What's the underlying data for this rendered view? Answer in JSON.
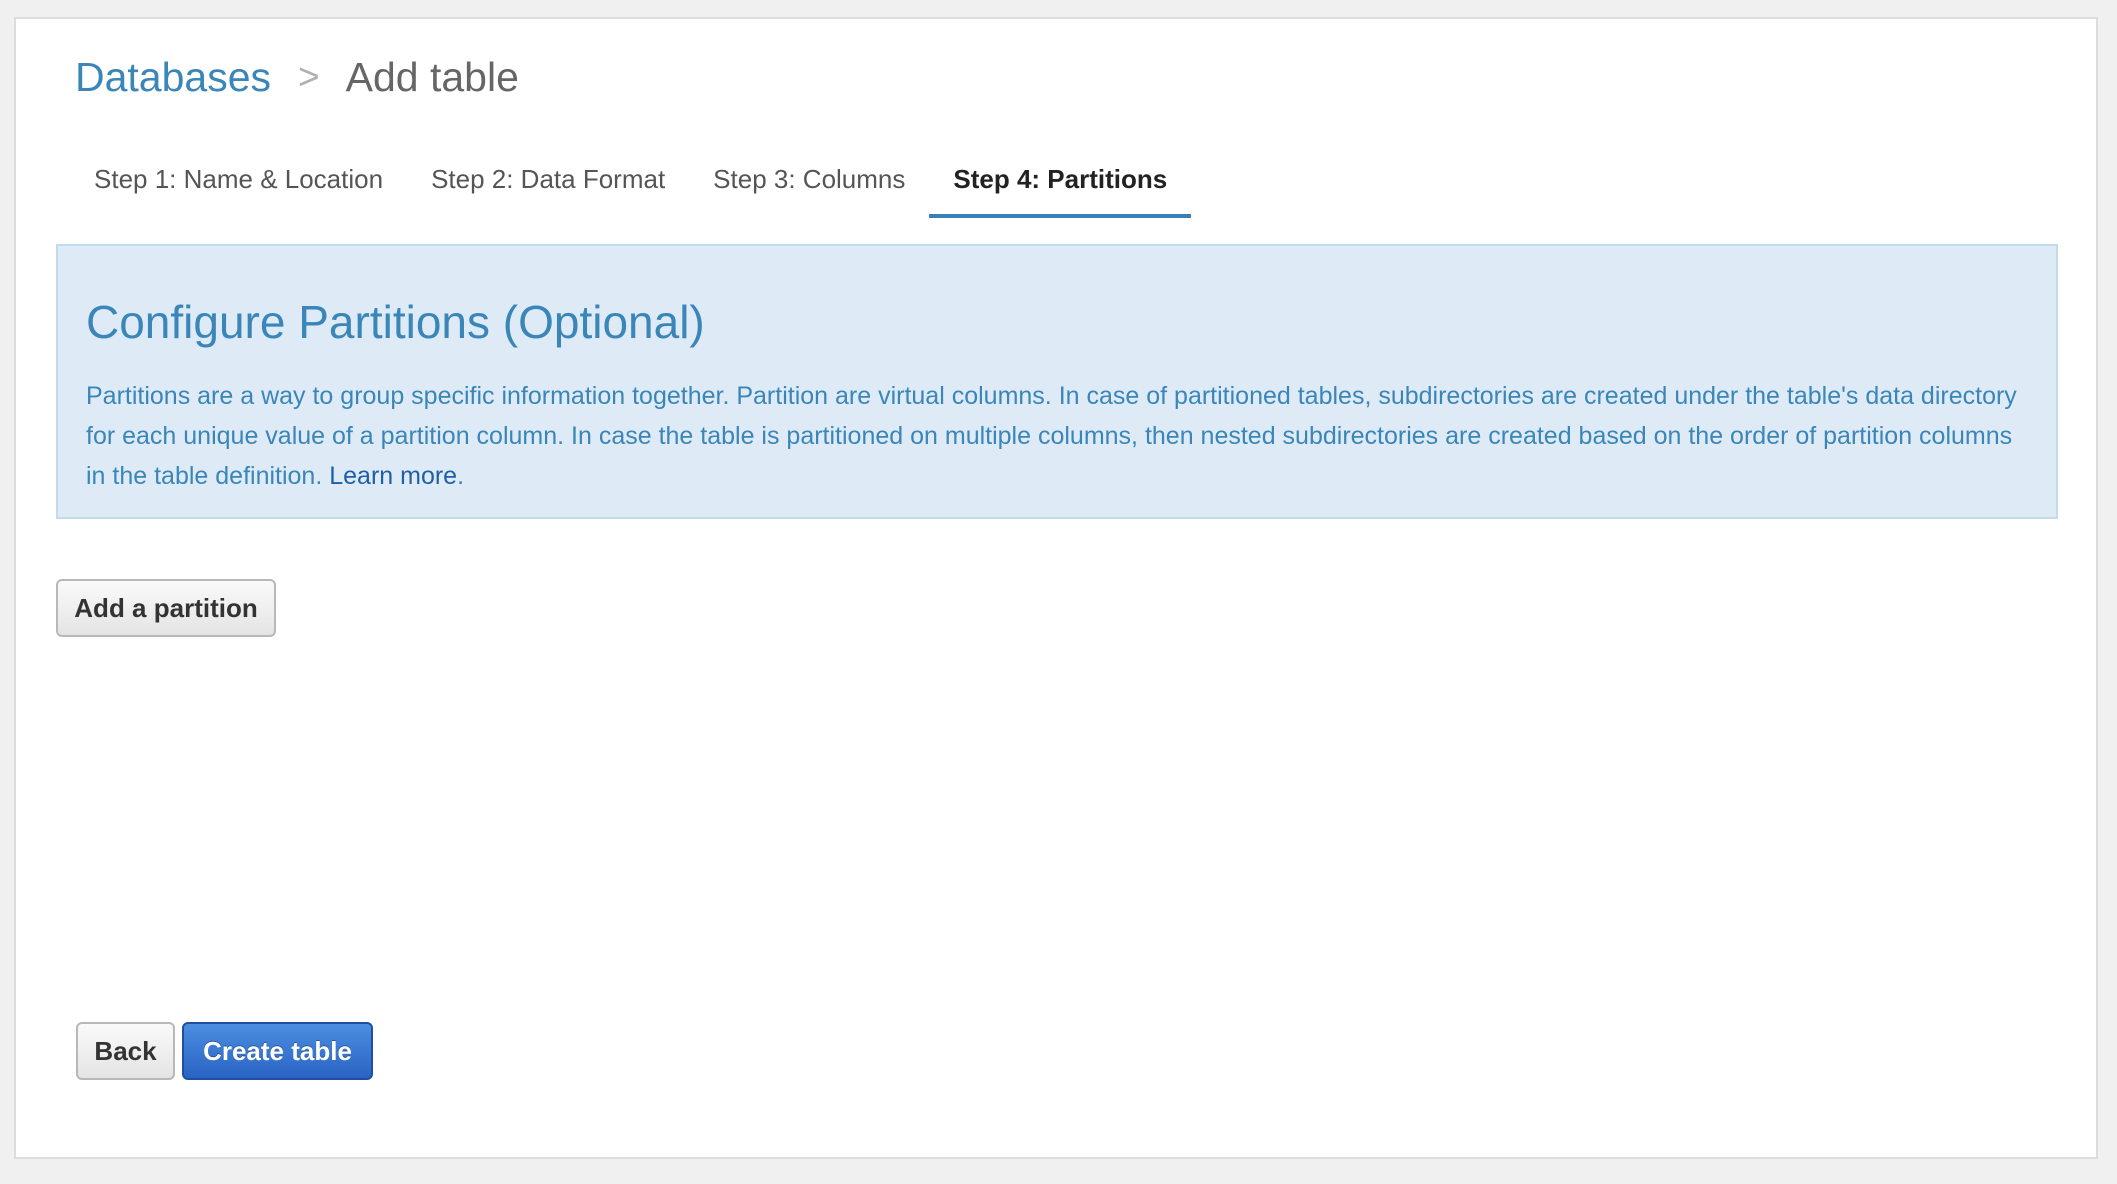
{
  "breadcrumb": {
    "parent": "Databases",
    "separator": ">",
    "current": "Add table"
  },
  "tabs": [
    {
      "label": "Step 1: Name & Location",
      "active": false
    },
    {
      "label": "Step 2: Data Format",
      "active": false
    },
    {
      "label": "Step 3: Columns",
      "active": false
    },
    {
      "label": "Step 4: Partitions",
      "active": true
    }
  ],
  "info": {
    "title": "Configure Partitions (Optional)",
    "body": "Partitions are a way to group specific information together. Partition are virtual columns. In case of partitioned tables, subdirectories are created under the table's data directory for each unique value of a partition column. In case the table is partitioned on multiple columns, then nested subdirectories are created based on the order of partition columns in the table definition. ",
    "link_label": "Learn more",
    "trailing": "."
  },
  "actions": {
    "add_partition_label": "Add a partition",
    "back_label": "Back",
    "create_label": "Create table"
  },
  "colors": {
    "accent": "#3a86b8",
    "panel_bg": "#deebf6",
    "primary_button": "#2a63c4"
  }
}
